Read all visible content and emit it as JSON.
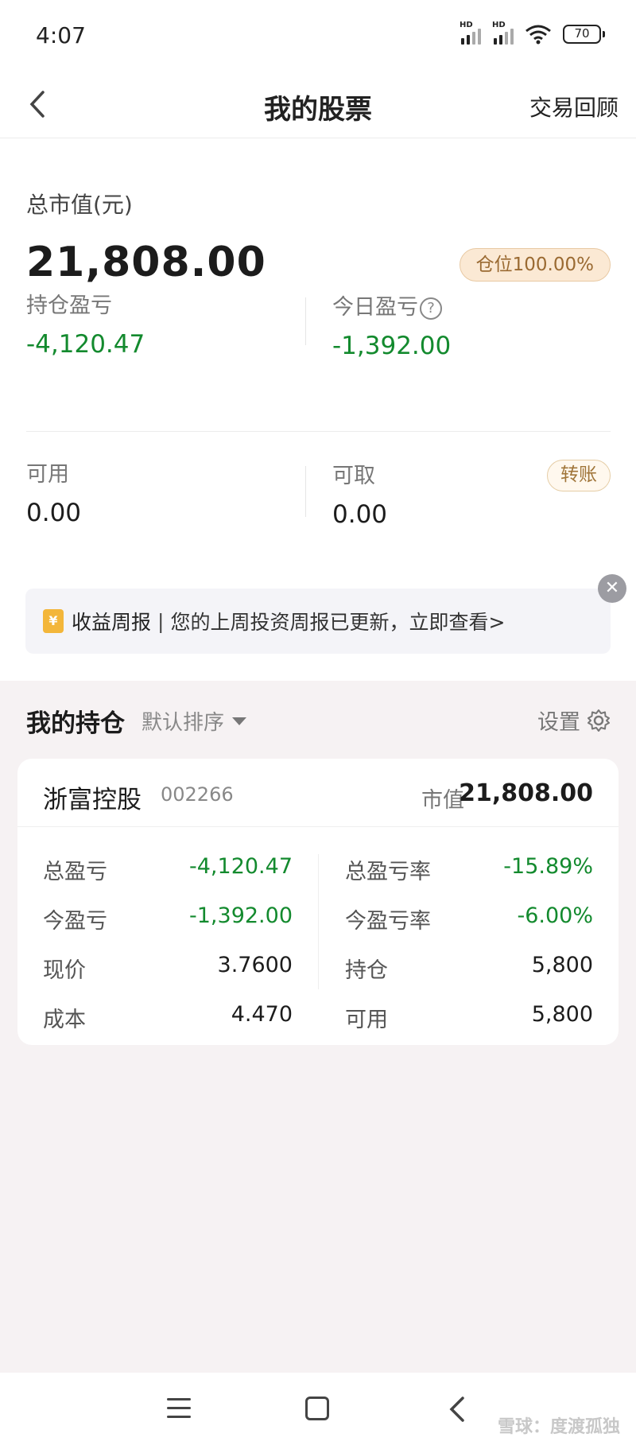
{
  "status_bar": {
    "time": "4:07",
    "battery": "70"
  },
  "nav": {
    "title": "我的股票",
    "right_action": "交易回顾"
  },
  "summary": {
    "total_label": "总市值(元)",
    "total_value": "21,808.00",
    "position_badge": "仓位100.00%",
    "holding_pl_label": "持仓盈亏",
    "holding_pl_value": "-4,120.47",
    "today_pl_label": "今日盈亏",
    "today_pl_value": "-1,392.00",
    "available_label": "可用",
    "available_value": "0.00",
    "withdrawable_label": "可取",
    "withdrawable_value": "0.00",
    "transfer_label": "转账"
  },
  "report_banner": {
    "icon": "¥",
    "title": "收益周报",
    "separator": "|",
    "text": "您的上周投资周报已更新，立即查看>"
  },
  "holdings": {
    "title": "我的持仓",
    "sort_label": "默认排序",
    "settings_label": "设置"
  },
  "stock": {
    "name": "浙富控股",
    "code": "002266",
    "market_value_label": "市值",
    "market_value": "21,808.00",
    "left_rows": [
      {
        "label": "总盈亏",
        "value": "-4,120.47"
      },
      {
        "label": "今盈亏",
        "value": "-1,392.00"
      },
      {
        "label": "现价",
        "value": "3.7600"
      },
      {
        "label": "成本",
        "value": "4.470"
      }
    ],
    "right_rows": [
      {
        "label": "总盈亏率",
        "value": "-15.89%"
      },
      {
        "label": "今盈亏率",
        "value": "-6.00%"
      },
      {
        "label": "持仓",
        "value": "5,800"
      },
      {
        "label": "可用",
        "value": "5,800"
      }
    ]
  },
  "watermark": "雪球：度渡孤独",
  "colors": {
    "loss_green": "#138a2e",
    "badge_bg": "#fbe9d4",
    "accent_gold": "#a07539"
  }
}
